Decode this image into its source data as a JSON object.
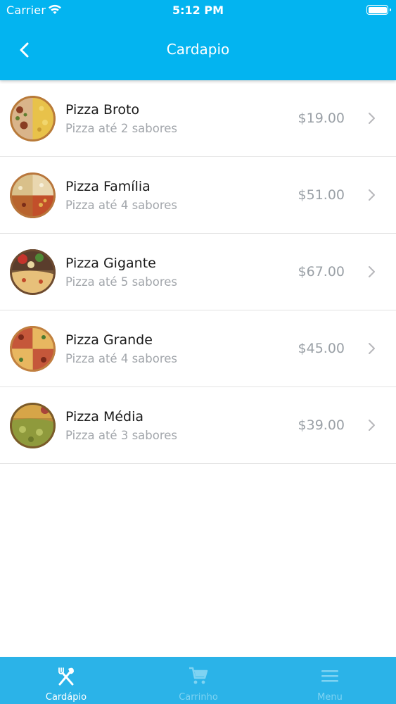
{
  "status_bar": {
    "carrier": "Carrier",
    "time": "5:12 PM"
  },
  "header": {
    "title": "Cardapio"
  },
  "colors": {
    "primary": "#03b4f0",
    "tab_bar": "#2bb3e8",
    "inactive_tab": "#7fd3f2",
    "price_text": "#9aa0a6"
  },
  "menu_items": [
    {
      "name": "Pizza Broto",
      "subtitle": "Pizza até 2 sabores",
      "price": "$19.00"
    },
    {
      "name": "Pizza Família",
      "subtitle": "Pizza até 4 sabores",
      "price": "$51.00"
    },
    {
      "name": "Pizza Gigante",
      "subtitle": "Pizza até 5 sabores",
      "price": "$67.00"
    },
    {
      "name": "Pizza Grande",
      "subtitle": "Pizza até 4 sabores",
      "price": "$45.00"
    },
    {
      "name": "Pizza Média",
      "subtitle": "Pizza até 3 sabores",
      "price": "$39.00"
    }
  ],
  "tab_bar": {
    "tabs": [
      {
        "label": "Cardápio",
        "icon": "fork-knife-icon",
        "active": true
      },
      {
        "label": "Carrinho",
        "icon": "cart-icon",
        "active": false
      },
      {
        "label": "Menu",
        "icon": "hamburger-menu-icon",
        "active": false
      }
    ]
  }
}
